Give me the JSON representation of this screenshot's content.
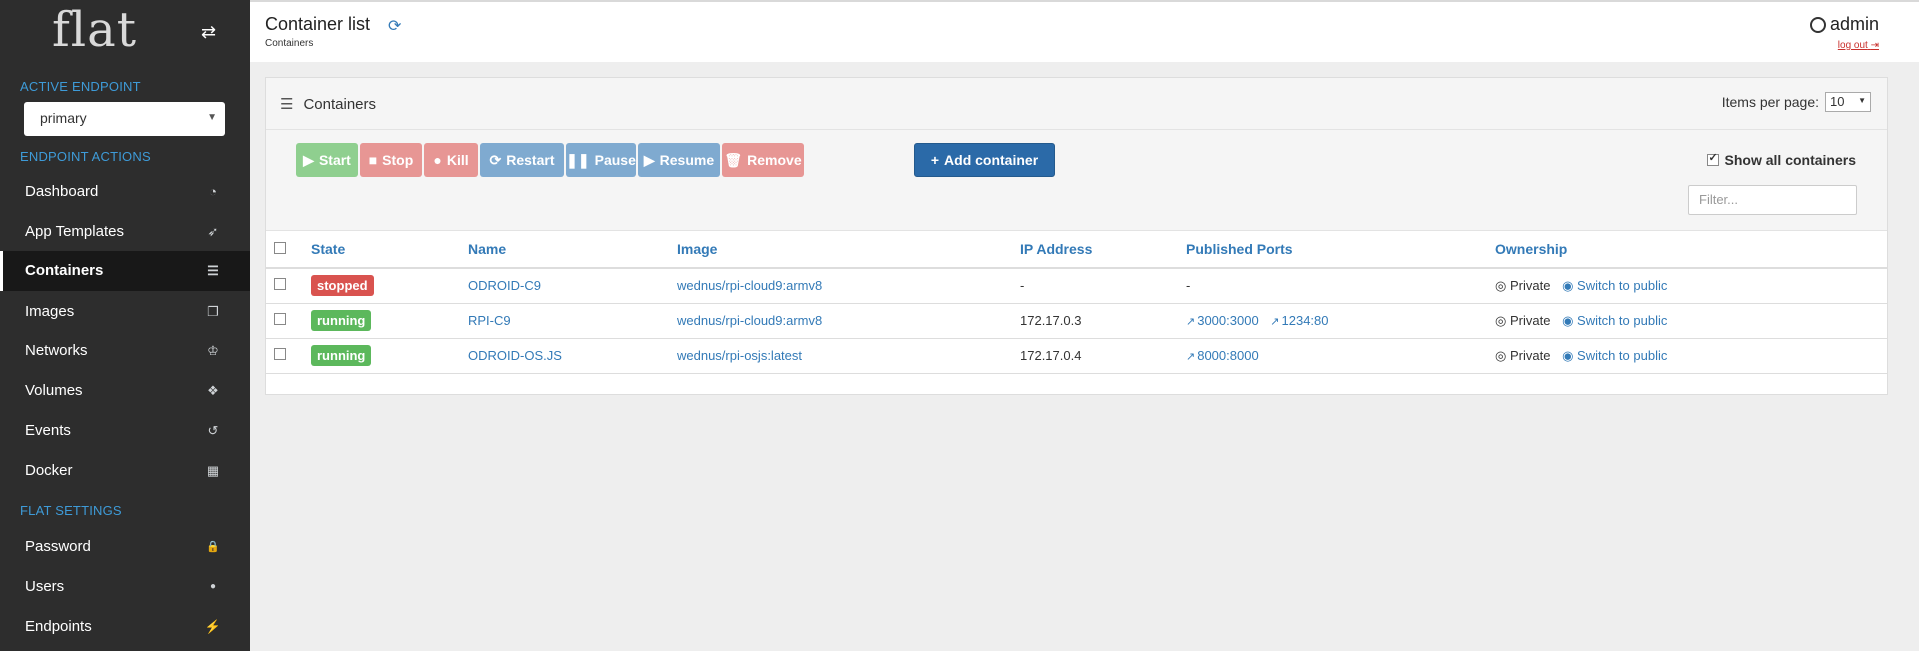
{
  "brand": {
    "name": "flat",
    "toggle_icon": "exchange-icon"
  },
  "sidebar": {
    "active_endpoint_title": "ACTIVE ENDPOINT",
    "endpoint_selected": "primary",
    "endpoint_actions_title": "ENDPOINT ACTIONS",
    "flat_settings_title": "FLAT SETTINGS",
    "items": [
      {
        "label": "Dashboard",
        "icon": "tachometer-icon",
        "glyph": "◔"
      },
      {
        "label": "App Templates",
        "icon": "rocket-icon",
        "glyph": "➶"
      },
      {
        "label": "Containers",
        "icon": "server-icon",
        "glyph": "☰"
      },
      {
        "label": "Images",
        "icon": "clone-icon",
        "glyph": "❐"
      },
      {
        "label": "Networks",
        "icon": "sitemap-icon",
        "glyph": "♔"
      },
      {
        "label": "Volumes",
        "icon": "cubes-icon",
        "glyph": "❖"
      },
      {
        "label": "Events",
        "icon": "history-icon",
        "glyph": "↺"
      },
      {
        "label": "Docker",
        "icon": "th-icon",
        "glyph": "▦"
      }
    ],
    "settings_items": [
      {
        "label": "Password",
        "icon": "lock-icon",
        "glyph": "🔒"
      },
      {
        "label": "Users",
        "icon": "user-icon",
        "glyph": "●"
      },
      {
        "label": "Endpoints",
        "icon": "plug-icon",
        "glyph": "⚡"
      }
    ]
  },
  "header": {
    "title": "Container list",
    "breadcrumb": "Containers",
    "user": "admin",
    "logout": "log out"
  },
  "panel": {
    "title": "Containers",
    "items_per_page_label": "Items per page:",
    "items_per_page_value": "10",
    "show_all_label": "Show all containers",
    "filter_placeholder": "Filter..."
  },
  "toolbar": {
    "start": "Start",
    "stop": "Stop",
    "kill": "Kill",
    "restart": "Restart",
    "pause": "Pause",
    "resume": "Resume",
    "remove": "Remove",
    "add": "Add container"
  },
  "table": {
    "headers": [
      "State",
      "Name",
      "Image",
      "IP Address",
      "Published Ports",
      "Ownership"
    ],
    "rows": [
      {
        "state": "stopped",
        "name": "ODROID-C9",
        "image": "wednus/rpi-cloud9:armv8",
        "ip": "-",
        "ports": [
          "-"
        ],
        "owner": "Private",
        "switch": "Switch to public"
      },
      {
        "state": "running",
        "name": "RPI-C9",
        "image": "wednus/rpi-cloud9:armv8",
        "ip": "172.17.0.3",
        "ports": [
          "3000:3000",
          "1234:80"
        ],
        "owner": "Private",
        "switch": "Switch to public"
      },
      {
        "state": "running",
        "name": "ODROID-OS.JS",
        "image": "wednus/rpi-osjs:latest",
        "ip": "172.17.0.4",
        "ports": [
          "8000:8000"
        ],
        "owner": "Private",
        "switch": "Switch to public"
      }
    ]
  },
  "colors": {
    "sidebar_bg": "#2d2d2d",
    "accent": "#337ab7",
    "danger": "#d9534f",
    "success": "#5cb85c"
  }
}
